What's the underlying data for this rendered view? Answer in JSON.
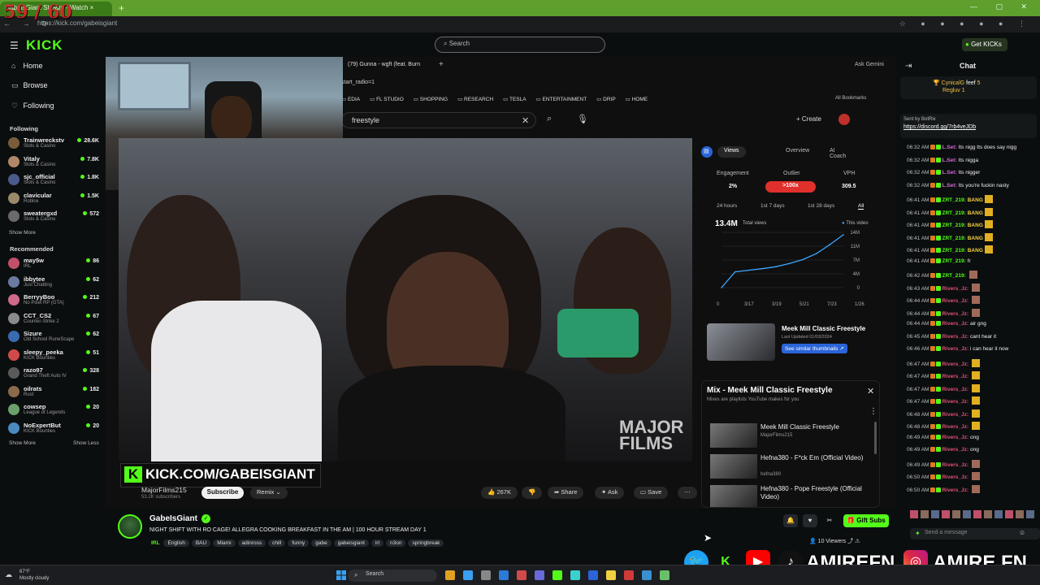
{
  "browser": {
    "tab_title": "GabeIsGiant Stream - Watch",
    "new_tab": "+",
    "url": "https://kick.com/gabeisgiant",
    "fps_overlay": "59 / 60"
  },
  "kick": {
    "logo": "KICK",
    "search_placeholder": "Search",
    "get_kicks": "Get KICKs",
    "nav": {
      "home": "Home",
      "browse": "Browse",
      "following": "Following"
    },
    "following_header": "Following",
    "following": [
      {
        "name": "Trainwreckstv",
        "game": "Slots & Casino",
        "viewers": "28.6K",
        "color": "#7a5c3a"
      },
      {
        "name": "Vitaly",
        "game": "Slots & Casino",
        "viewers": "7.8K",
        "color": "#b0876a"
      },
      {
        "name": "sjc_official",
        "game": "Slots & Casino",
        "viewers": "1.8K",
        "color": "#4a5a8a"
      },
      {
        "name": "clavicular",
        "game": "Roblox",
        "viewers": "1.5K",
        "color": "#9a8a6a"
      },
      {
        "name": "sweatergxd",
        "game": "Slots & Casino",
        "viewers": "572",
        "color": "#6a6a6a"
      }
    ],
    "show_more": "Show More",
    "show_less": "Show Less",
    "recommended_header": "Recommended",
    "recommended": [
      {
        "name": "may5w",
        "game": "IRL",
        "viewers": "86",
        "color": "#c0506a"
      },
      {
        "name": "ibbytee",
        "game": "Just Chatting",
        "viewers": "62",
        "color": "#6a7aa0"
      },
      {
        "name": "BerryyBoo",
        "game": "No Pixel RP (GTA)",
        "viewers": "212",
        "color": "#d06a8a"
      },
      {
        "name": "CCT_CS2",
        "game": "Counter-Strike 2",
        "viewers": "67",
        "color": "#8a8a8a"
      },
      {
        "name": "Sizure",
        "game": "Old School RuneScape",
        "viewers": "62",
        "color": "#3a6ab0"
      },
      {
        "name": "sleepy_peeka",
        "game": "KICK Bounties",
        "viewers": "51",
        "color": "#d04a4a"
      },
      {
        "name": "razo97",
        "game": "Grand Theft Auto IV",
        "viewers": "328",
        "color": "#5a5a5a"
      },
      {
        "name": "oilrats",
        "game": "Rust",
        "viewers": "182",
        "color": "#8a6a4a"
      },
      {
        "name": "cowsep",
        "game": "League of Legends",
        "viewers": "20",
        "color": "#6aa06a"
      },
      {
        "name": "NoExpertBut",
        "game": "KICK Bounties",
        "viewers": "20",
        "color": "#4a8ac0"
      }
    ]
  },
  "youtube": {
    "tab_title": "(79) Gunna - wgft (feat. Burn",
    "ask_gemini": "Ask Gemini",
    "bookmarks": [
      "EDIA",
      "FL STUDIO",
      "SHOPPING",
      "RESEARCH",
      "TESLA",
      "ENTERTAINMENT",
      "DRIP",
      "HOME"
    ],
    "all_bookmarks": "All Bookmarks",
    "address_fragment": "start_radio=1",
    "search_value": "freestyle",
    "create": "Create",
    "channel": "MajorFilms215",
    "subscribers": "53.2K subscribers",
    "subscribe": "Subscribe",
    "remix": "Remix",
    "likes": "267K",
    "share": "Share",
    "ask": "Ask",
    "save": "Save",
    "watermark": "MAJOR FILMS",
    "panel": {
      "tabs": [
        "Views",
        "Overview",
        "AI Coach"
      ],
      "engagement_label": "Engagement",
      "engagement": "2%",
      "outlier_label": "Outlier",
      "outlier": ">100x",
      "vph_label": "VPH",
      "vph": "309.5",
      "ranges": [
        "24 hours",
        "1st 7 days",
        "1st 28 days",
        "All"
      ],
      "total_views": "13.4M",
      "total_views_label": "Total views",
      "this_video": "This video",
      "related_title": "Meek Mill Classic Freestyle",
      "related_sub": "Last Updated 01/03/2024",
      "similar_btn": "See similar thumbnails"
    },
    "chart_data": {
      "type": "line",
      "x": [
        "0",
        "3/17",
        "3/19",
        "5/21",
        "7/23",
        "1/26"
      ],
      "y_ticks": [
        "14M",
        "11M",
        "7M",
        "4M",
        "0"
      ],
      "ylim": [
        0,
        14
      ],
      "series": [
        {
          "values": [
            0,
            4,
            4.4,
            4.8,
            5.3,
            6.1,
            7.1,
            8.6,
            10.9,
            13.4
          ]
        }
      ]
    },
    "mix": {
      "title": "Mix - Meek Mill Classic Freestyle",
      "subtitle": "Mixes are playlists YouTube makes for you",
      "items": [
        {
          "title": "Meek Mill Classic Freestyle",
          "channel": "MajorFilms215"
        },
        {
          "title": "Hefna380 - F*ck Em (Official Video)",
          "channel": "hefna380"
        },
        {
          "title": "Hefna380 - Pope Freestyle (Official Video)",
          "channel": ""
        }
      ]
    }
  },
  "overlay": {
    "banner": "KICK.COM/GABEISGIANT",
    "handle1": "AMIREFN",
    "handle2": "AMIRE.FN"
  },
  "stream": {
    "streamer": "GabeIsGiant",
    "title": "NIGHT SHIFT WITH RO CAGE! ALLEGRA COOKING BREAKFAST IN THE AM | 100 HOUR STREAM DAY 1",
    "live": "IRL",
    "tags": [
      "English",
      "BAU",
      "Miami",
      "adinross",
      "chill",
      "funny",
      "gabe",
      "gabeisgiant",
      "irl",
      "n3on",
      "springbreak"
    ],
    "gift_subs": "Gift Subs",
    "viewers": "10 Viewers"
  },
  "chat": {
    "header": "Chat",
    "pinned_user": "CynicalG",
    "pinned_text": "feef",
    "pinned_user2": "Regluv",
    "pinned_count1": "5",
    "pinned_count2": "1",
    "discord_by": "Sent by BotRix",
    "discord_link": "https://discord.gg/7rb4veJDb",
    "messages": [
      {
        "time": "06:32 AM",
        "user": "L.Set:",
        "text": "Its nigg tts does say nigg",
        "color": "#d86ad8",
        "emote": ""
      },
      {
        "time": "06:32 AM",
        "user": "L.Set:",
        "text": "Its nigga",
        "color": "#d86ad8",
        "emote": ""
      },
      {
        "time": "06:32 AM",
        "user": "L.Set:",
        "text": "Its nigger",
        "color": "#d86ad8",
        "emote": ""
      },
      {
        "time": "06:32 AM",
        "user": "L.Set:",
        "text": "Its you're fuckin nasty",
        "color": "#d86ad8",
        "emote": ""
      },
      {
        "time": "06:41 AM",
        "user": "ZRT_219:",
        "text": "BANG",
        "color": "#53fc18",
        "emote": "yellow"
      },
      {
        "time": "06:41 AM",
        "user": "ZRT_219:",
        "text": "BANG",
        "color": "#53fc18",
        "emote": "yellow"
      },
      {
        "time": "06:41 AM",
        "user": "ZRT_219:",
        "text": "BANG",
        "color": "#53fc18",
        "emote": "yellow"
      },
      {
        "time": "06:41 AM",
        "user": "ZRT_219:",
        "text": "BANG",
        "color": "#53fc18",
        "emote": "yellow"
      },
      {
        "time": "06:41 AM",
        "user": "ZRT_219:",
        "text": "BANG",
        "color": "#53fc18",
        "emote": "yellow"
      },
      {
        "time": "06:41 AM",
        "user": "ZRT_219:",
        "text": "fr",
        "color": "#53fc18",
        "emote": ""
      },
      {
        "time": "06:42 AM",
        "user": "ZRT_219:",
        "text": "",
        "color": "#53fc18",
        "emote": "pic"
      },
      {
        "time": "06:43 AM",
        "user": "Rivers_Jz:",
        "text": "",
        "color": "#e0507a",
        "emote": "pic"
      },
      {
        "time": "06:44 AM",
        "user": "Rivers_Jz:",
        "text": "",
        "color": "#e0507a",
        "emote": "pic"
      },
      {
        "time": "06:44 AM",
        "user": "Rivers_Jz:",
        "text": "",
        "color": "#e0507a",
        "emote": "pic"
      },
      {
        "time": "06:44 AM",
        "user": "Rivers_Jz:",
        "text": "air gng",
        "color": "#e0507a",
        "emote": ""
      },
      {
        "time": "06:45 AM",
        "user": "Rivers_Jz:",
        "text": "cant hear it",
        "color": "#e0507a",
        "emote": ""
      },
      {
        "time": "06:46 AM",
        "user": "Rivers_Jz:",
        "text": "i can hear it now",
        "color": "#e0507a",
        "emote": ""
      },
      {
        "time": "06:47 AM",
        "user": "Rivers_Jz:",
        "text": "",
        "color": "#e0507a",
        "emote": "yellow"
      },
      {
        "time": "06:47 AM",
        "user": "Rivers_Jz:",
        "text": "",
        "color": "#e0507a",
        "emote": "yellow"
      },
      {
        "time": "06:47 AM",
        "user": "Rivers_Jz:",
        "text": "",
        "color": "#e0507a",
        "emote": "yellow"
      },
      {
        "time": "06:47 AM",
        "user": "Rivers_Jz:",
        "text": "",
        "color": "#e0507a",
        "emote": "yellow"
      },
      {
        "time": "06:48 AM",
        "user": "Rivers_Jz:",
        "text": "",
        "color": "#e0507a",
        "emote": "yellow"
      },
      {
        "time": "06:48 AM",
        "user": "Rivers_Jz:",
        "text": "",
        "color": "#e0507a",
        "emote": "yellow"
      },
      {
        "time": "06:49 AM",
        "user": "Rivers_Jz:",
        "text": "ong",
        "color": "#e0507a",
        "emote": ""
      },
      {
        "time": "06:49 AM",
        "user": "Rivers_Jz:",
        "text": "ong",
        "color": "#e0507a",
        "emote": ""
      },
      {
        "time": "06:49 AM",
        "user": "Rivers_Jz:",
        "text": "",
        "color": "#e0507a",
        "emote": "pic"
      },
      {
        "time": "06:50 AM",
        "user": "Rivers_Jz:",
        "text": "",
        "color": "#e0507a",
        "emote": "pic"
      },
      {
        "time": "06:50 AM",
        "user": "Rivers_Jz:",
        "text": "",
        "color": "#e0507a",
        "emote": "pic"
      }
    ],
    "input_placeholder": "Send a message"
  },
  "taskbar": {
    "weather_temp": "67°F",
    "weather_desc": "Mostly cloudy",
    "search": "Search"
  },
  "colors": {
    "kick_green": "#53fc18",
    "outlier_red": "#e0302c",
    "youtube_blue": "#3ea6ff"
  }
}
